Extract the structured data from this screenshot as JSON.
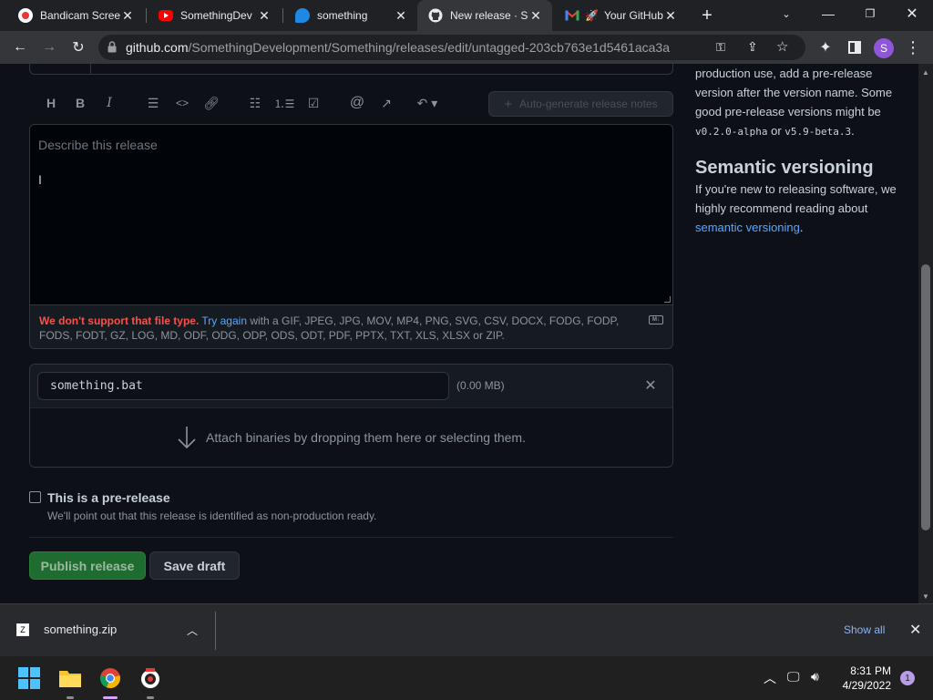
{
  "browser": {
    "tabs": [
      {
        "title": "Bandicam Scree",
        "icon": "record-icon"
      },
      {
        "title": "SomethingDev",
        "icon": "youtube-icon"
      },
      {
        "title": "something",
        "icon": "app-icon"
      },
      {
        "title": "New release · So",
        "icon": "github-icon",
        "active": true
      },
      {
        "title": "Your GitHub",
        "icon": "gmail-icon"
      }
    ],
    "url_host": "github.com",
    "url_path": "/SomethingDevelopment/Something/releases/edit/untagged-203cb763e1d5461aca3a",
    "profile_initial": "S"
  },
  "editor": {
    "autogen_label": "Auto-generate release notes",
    "placeholder": "Describe this release",
    "upload_error": "We don't support that file type.",
    "try_again": "Try again",
    "upload_types": "with a GIF, JPEG, JPG, MOV, MP4, PNG, SVG, CSV, DOCX, FODG, FODP, FODS, FODT, GZ, LOG, MD, ODF, ODG, ODP, ODS, ODT, PDF, PPTX, TXT, XLS, XLSX or ZIP.",
    "md_badge": "M↓"
  },
  "attachment": {
    "file_name": "something.bat",
    "file_size": "(0.00 MB)",
    "drop_text": "Attach binaries by dropping them here or selecting them."
  },
  "prerelease": {
    "label": "This is a pre-release",
    "note": "We'll point out that this release is identified as non-production ready."
  },
  "actions": {
    "publish": "Publish release",
    "save_draft": "Save draft"
  },
  "sidebar": {
    "p1_before": "production use, add a pre-release version after the version name. Some good pre-release versions might be ",
    "code1": "v0.2.0-alpha",
    "or": " or ",
    "code2": "v5.9-beta.3",
    "period": ".",
    "semver_heading": "Semantic versioning",
    "p2_before": "If you're new to releasing software, we highly recommend reading about ",
    "semver_link": "semantic versioning",
    "p2_after": "."
  },
  "downloads": {
    "file": "something.zip",
    "show_all": "Show all"
  },
  "taskbar": {
    "time": "8:31 PM",
    "date": "4/29/2022",
    "notifications": "1"
  },
  "colors": {
    "page_bg": "#0d1117",
    "accent_link": "#58a6ff",
    "publish_green": "#238636",
    "error_red": "#f85149"
  }
}
